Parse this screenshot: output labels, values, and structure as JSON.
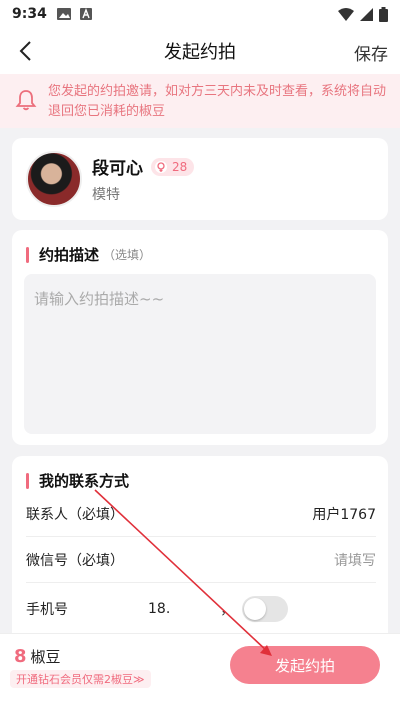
{
  "status_bar": {
    "time": "9:34"
  },
  "navbar": {
    "title": "发起约拍",
    "save_label": "保存"
  },
  "notice": {
    "text": "您发起的约拍邀请，如对方三天内未及时查看，系统将自动退回您已消耗的椒豆"
  },
  "profile": {
    "name": "段可心",
    "badge_count": "28",
    "role": "模特"
  },
  "description": {
    "title": "约拍描述",
    "subtitle": "（选填）",
    "placeholder": "请输入约拍描述~~"
  },
  "contact": {
    "title": "我的联系方式",
    "contact_person_label": "联系人（必填）",
    "contact_person_value": "用户1767",
    "wechat_label": "微信号（必填）",
    "wechat_placeholder": "请填写",
    "phone_label": "手机号",
    "phone_value": "18.",
    "phone_comma": "，"
  },
  "bottom": {
    "beans_count": "8",
    "beans_unit": "椒豆",
    "vip_tip": "开通钻石会员仅需2椒豆≫",
    "submit_label": "发起约拍"
  },
  "colors": {
    "accent": "#f06b7e",
    "notice_bg": "#fdeff1",
    "button": "#f5818f",
    "annotation_arrow": "#e0303a"
  }
}
